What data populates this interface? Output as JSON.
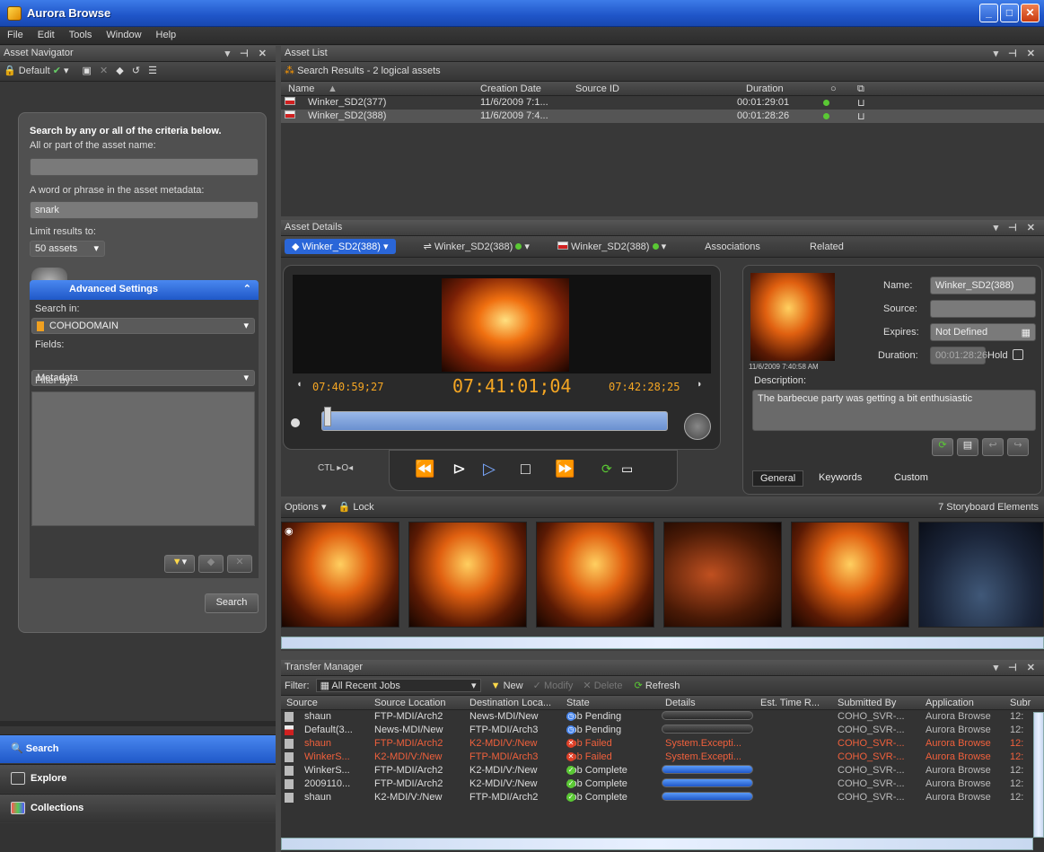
{
  "app": {
    "title": "Aurora Browse"
  },
  "menu": [
    "File",
    "Edit",
    "Tools",
    "Window",
    "Help"
  ],
  "navigator": {
    "header": "Asset Navigator",
    "toolbar_profile": "Default",
    "search_title": "Search by any or all of the criteria below.",
    "name_label": "All or part of the asset name:",
    "name_value": "",
    "meta_label": "A word or phrase in the asset metadata:",
    "meta_value": "snark",
    "limit_label": "Limit results to:",
    "limit_value": "50 assets",
    "advanced_title": "Advanced Settings",
    "search_in_label": "Search in:",
    "search_in_value": "COHODOMAIN",
    "fields_label": "Fields:",
    "fields_value": "Metadata",
    "filter_label": "Filter by:",
    "search_button": "Search",
    "nav_items": [
      "Search",
      "Explore",
      "Collections"
    ]
  },
  "asset_list": {
    "header": "Asset List",
    "summary": "Search Results - 2 logical assets",
    "columns": [
      "Name",
      "Creation Date",
      "Source ID",
      "Duration"
    ],
    "rows": [
      {
        "name": "Winker_SD2(377)",
        "date": "11/6/2009 7:1...",
        "source": "",
        "duration": "00:01:29:01"
      },
      {
        "name": "Winker_SD2(388)",
        "date": "11/6/2009 7:4...",
        "source": "",
        "duration": "00:01:28:26"
      }
    ]
  },
  "details": {
    "header": "Asset Details",
    "tabs": [
      "Winker_SD2(388)",
      "Winker_SD2(388)",
      "Winker_SD2(388)",
      "Associations",
      "Related"
    ],
    "tc_in": "07:40:59;27",
    "tc_current": "07:41:01;04",
    "tc_out": "07:42:28;25",
    "ctl": "CTL ▸O◂",
    "name_label": "Name:",
    "name_value": "Winker_SD2(388)",
    "source_label": "Source:",
    "source_value": "",
    "expires_label": "Expires:",
    "expires_value": "Not Defined",
    "duration_label": "Duration:",
    "duration_value": "00:01:28:26",
    "hold_label": "Hold",
    "thumb_date": "11/6/2009 7:40:58 AM",
    "desc_label": "Description:",
    "desc_value": "The barbecue party was getting a bit enthusiastic",
    "bottom_tabs": [
      "General",
      "Keywords",
      "Custom"
    ]
  },
  "storyboard": {
    "options": "Options",
    "lock": "Lock",
    "count": "7 Storyboard Elements"
  },
  "transfer": {
    "header": "Transfer Manager",
    "filter_label": "Filter:",
    "filter_value": "All Recent Jobs",
    "new": "New",
    "modify": "Modify",
    "delete": "Delete",
    "refresh": "Refresh",
    "columns": [
      "Source",
      "Source Location",
      "Destination Loca...",
      "State",
      "Details",
      "Est. Time R...",
      "Submitted By",
      "Application",
      "Subr"
    ],
    "rows": [
      {
        "source": "shaun",
        "src_loc": "FTP-MDI/Arch2",
        "dst": "News-MDI/New",
        "state": "Job Pending",
        "details": "",
        "by": "COHO_SVR-...",
        "app": "Aurora Browse",
        "sub": "12:",
        "kind": "pending",
        "failed": false
      },
      {
        "source": "Default(3...",
        "src_loc": "News-MDI/New",
        "dst": "FTP-MDI/Arch3",
        "state": "Job Pending",
        "details": "",
        "by": "COHO_SVR-...",
        "app": "Aurora Browse",
        "sub": "12:",
        "kind": "pending",
        "failed": false
      },
      {
        "source": "shaun",
        "src_loc": "FTP-MDI/Arch2",
        "dst": "K2-MDI/V:/New",
        "state": "Job Failed",
        "details": "System.Excepti...",
        "by": "COHO_SVR-...",
        "app": "Aurora Browse",
        "sub": "12:",
        "kind": "failed",
        "failed": true
      },
      {
        "source": "WinkerS...",
        "src_loc": "K2-MDI/V:/New",
        "dst": "FTP-MDI/Arch3",
        "state": "Job Failed",
        "details": "System.Excepti...",
        "by": "COHO_SVR-...",
        "app": "Aurora Browse",
        "sub": "12:",
        "kind": "failed",
        "failed": true
      },
      {
        "source": "WinkerS...",
        "src_loc": "FTP-MDI/Arch2",
        "dst": "K2-MDI/V:/New",
        "state": "Job Complete",
        "details": "",
        "by": "COHO_SVR-...",
        "app": "Aurora Browse",
        "sub": "12:",
        "kind": "complete",
        "failed": false
      },
      {
        "source": "2009110...",
        "src_loc": "FTP-MDI/Arch2",
        "dst": "K2-MDI/V:/New",
        "state": "Job Complete",
        "details": "",
        "by": "COHO_SVR-...",
        "app": "Aurora Browse",
        "sub": "12:",
        "kind": "complete",
        "failed": false
      },
      {
        "source": "shaun",
        "src_loc": "K2-MDI/V:/New",
        "dst": "FTP-MDI/Arch2",
        "state": "Job Complete",
        "details": "",
        "by": "COHO_SVR-...",
        "app": "Aurora Browse",
        "sub": "12:",
        "kind": "complete",
        "failed": false
      }
    ]
  },
  "colors": {
    "accent": "#2a66d8",
    "timecode": "#f5a623",
    "failed": "#f0603c",
    "ok": "#5ac834"
  }
}
